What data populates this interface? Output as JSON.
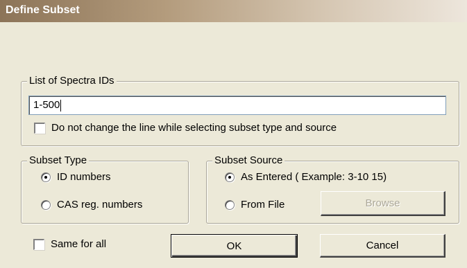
{
  "window": {
    "title": "Define Subset"
  },
  "spectra_ids": {
    "label": "List of  Spectra IDs",
    "value": "1-500",
    "keep_line_checkbox": {
      "label": "Do not change the line while selecting subset type and source",
      "checked": false
    }
  },
  "subset_type": {
    "label": "Subset Type",
    "options": [
      {
        "label": "ID numbers",
        "selected": true
      },
      {
        "label": "CAS reg. numbers",
        "selected": false
      }
    ]
  },
  "subset_source": {
    "label": "Subset Source",
    "options": [
      {
        "label": "As Entered ( Example: 3-10 15)",
        "selected": true
      },
      {
        "label": "From File",
        "selected": false
      }
    ],
    "browse_label": "Browse"
  },
  "footer": {
    "same_for_all": {
      "label": "Same for all",
      "checked": false
    },
    "ok_label": "OK",
    "cancel_label": "Cancel"
  }
}
